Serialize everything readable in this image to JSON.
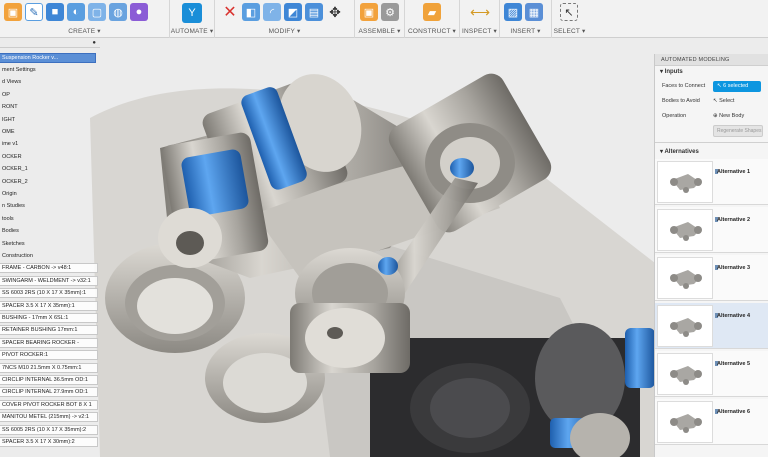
{
  "toolbar": {
    "groups": [
      {
        "label": "CREATE ▾"
      },
      {
        "label": "AUTOMATE ▾"
      },
      {
        "label": "MODIFY ▾"
      },
      {
        "label": "ASSEMBLE ▾"
      },
      {
        "label": "CONSTRUCT ▾"
      },
      {
        "label": "INSPECT ▾"
      },
      {
        "label": "INSERT ▾"
      },
      {
        "label": "SELECT ▾"
      }
    ]
  },
  "browser": {
    "header_selected": "Suspension Rocker v...",
    "items": [
      "ment Settings",
      "d Views",
      "OP",
      "RONT",
      "IGHT",
      "OME",
      "ime v1",
      "OCKER",
      "OCKER_1",
      "OCKER_2",
      "Origin",
      "n Studies",
      "tools",
      "Bodies",
      "Sketches",
      "Construction",
      "FRAME - CARBON -> v48:1",
      "SWINGARM - WELDMENT -> v32:1",
      "SS 6003 2RS (10 X 17 X 35mm):1",
      "SPACER 3.5 X 17 X 35mm):1",
      "BUSHING - 17mm X 6SL:1",
      "RETAINER BUSHING 17mm:1",
      "SPACER BEARING ROCKER -",
      "PIVOT ROCKER:1",
      "7NCS M10 21.5mm X 0.75mm:1",
      "CIRCLIP INTERNAL 36.5mm OD:1",
      "CIRCLIP INTERNAL 27.9mm OD:1",
      "COVER PIVOT ROCKER BOT 8 X 1",
      "MANITOU METEL (215mm) -> v2:1",
      "SS 6005 2RS (10 X 17 X 35mm):2",
      "SPACER 3.5 X 17 X 30mm):2"
    ]
  },
  "panel": {
    "title": "AUTOMATED MODELING",
    "inputs_header": "Inputs",
    "faces_label": "Faces to Connect",
    "faces_value": "6 selected",
    "avoid_label": "Bodies to Avoid",
    "avoid_value": "Select",
    "operation_label": "Operation",
    "operation_value": "New Body",
    "generate_label": "Regenerate Shapes",
    "alternatives_header": "Alternatives",
    "alternatives": [
      "Alternative 1",
      "Alternative 2",
      "Alternative 3",
      "Alternative 4",
      "Alternative 5",
      "Alternative 6"
    ]
  },
  "colors": {
    "accent": "#0d96e0",
    "metal": "#b9b6b0",
    "bushing_blue": "#3a86d9"
  }
}
